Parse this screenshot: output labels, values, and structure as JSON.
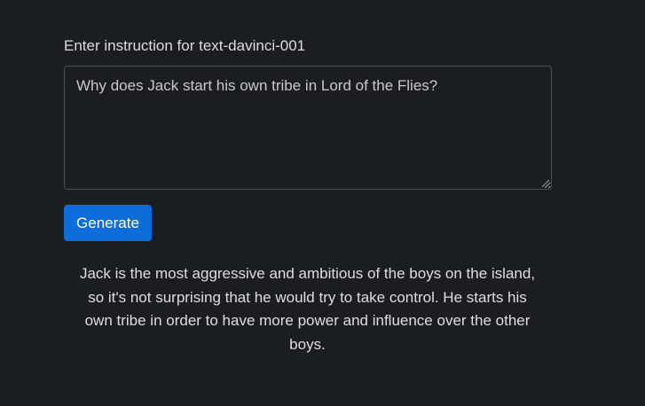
{
  "form": {
    "label": "Enter instruction for text-davinci-001",
    "instruction_value": "Why does Jack start his own tribe in Lord of the Flies?",
    "generate_label": "Generate"
  },
  "output": {
    "text": "Jack is the most aggressive and ambitious of the boys on the island, so it's not surprising that he would try to take control. He starts his own tribe in order to have more power and influence over the other boys."
  },
  "theme": {
    "background": "#1b1e21",
    "accent": "#0d6edb",
    "text": "#dedede",
    "border": "#4a4f55"
  },
  "icons": {
    "resize_grip": "resize-grip-icon"
  }
}
